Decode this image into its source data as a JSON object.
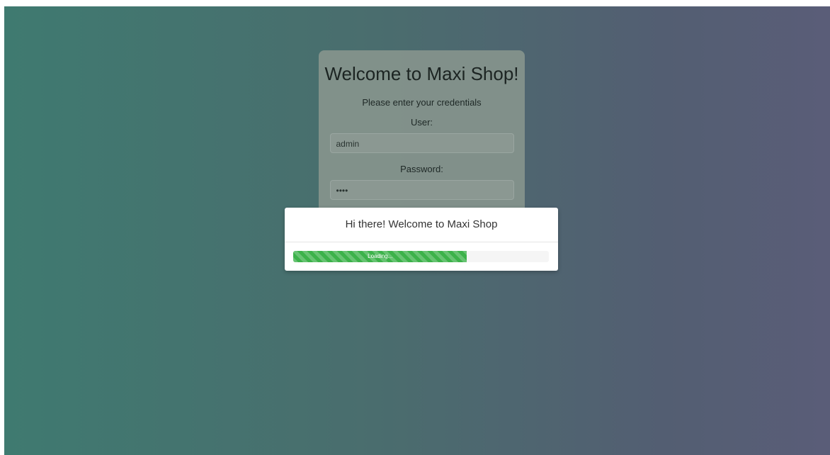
{
  "login": {
    "title": "Welcome to Maxi Shop!",
    "subtitle": "Please enter your credentials",
    "user_label": "User:",
    "user_value": "admin",
    "password_label": "Password:",
    "password_value": "••••"
  },
  "modal": {
    "title": "Hi there! Welcome to Maxi Shop",
    "progress_label": "Loading...",
    "progress_fraction": 0.68
  },
  "colors": {
    "gradient_start": "#3f7a70",
    "gradient_end": "#5a5d78",
    "progress_fill": "#3cb24a",
    "modal_background": "#ffffff"
  }
}
